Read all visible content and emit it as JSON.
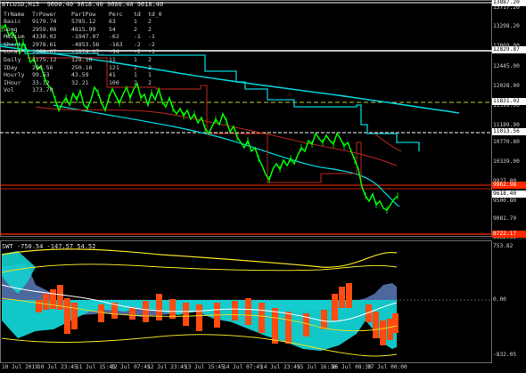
{
  "header": {
    "title": "BTCUSD,M15  9600.40 9618.40 9600.40 9618.40"
  },
  "legend": {
    "columns": [
      "TrName",
      "TrPower",
      "PartPow",
      "Perc",
      "td",
      "td_0"
    ],
    "rows": [
      [
        "Basic",
        "9179.74",
        "5785.12",
        "63",
        "1",
        "2"
      ],
      [
        "Long",
        "2959.06",
        "4815.99",
        "54",
        "2",
        "2"
      ],
      [
        "Medium",
        "4330.02",
        "-1947.07",
        "-62",
        "-1",
        "-1"
      ],
      [
        "Short",
        "2978.61",
        "-4853.56",
        "-163",
        "-2",
        "-2"
      ],
      [
        "Local",
        "2001.07",
        "-1874.07",
        "-94",
        "-2",
        "-1"
      ],
      [
        "Daily",
        "1175.12",
        "128.10",
        "11",
        "1",
        "2"
      ],
      [
        "IDay",
        "206.56",
        "250.16",
        "121",
        "2",
        "2"
      ],
      [
        "Hourly",
        "99.53",
        "43.59",
        "41",
        "1",
        "1"
      ],
      [
        "IHour",
        "33.12",
        "32.21",
        "100",
        "2",
        "2"
      ],
      [
        "Vol",
        "173.70",
        "",
        "",
        "",
        ""
      ]
    ]
  },
  "indicator_title": "SWT -750.54 -147.57 54.52",
  "price_axis": [
    "13717.20",
    "13298.20",
    "12869.00",
    "12445.00",
    "12028.00",
    "11599.00",
    "11189.90",
    "10770.80",
    "10339.00",
    "9927.00",
    "9500.80",
    "9081.70",
    "8662.60"
  ],
  "price_tags": [
    {
      "value": "13887.20",
      "bg": "#ffffff",
      "fg": "#000000"
    },
    {
      "value": "12829.87",
      "bg": "#ffffff",
      "fg": "#000000"
    },
    {
      "value": "11831.02",
      "bg": "#ffffff",
      "fg": "#000000"
    },
    {
      "value": "11013.56",
      "bg": "#ffffff",
      "fg": "#000000"
    },
    {
      "value": "9962.98",
      "bg": "#ff2a00",
      "fg": "#ffffff"
    },
    {
      "value": "9618.40",
      "bg": "#ffffff",
      "fg": "#000000"
    },
    {
      "value": "8722.17",
      "bg": "#ff2a00",
      "fg": "#ffffff"
    }
  ],
  "indicator_axis": [
    "753.82",
    "0.00",
    "-832.05"
  ],
  "time_axis": [
    "10 Jul 2019",
    "10 Jul 23:45",
    "11 Jul 15:45",
    "12 Jul 07:45",
    "12 Jul 23:45",
    "13 Jul 15:45",
    "14 Jul 07:45",
    "14 Jul 23:45",
    "15 Jul 16:30",
    "16 Jul 08:30",
    "17 Jul 00:00"
  ],
  "colors": {
    "background": "#000000",
    "candles": "#00ff00",
    "cyan_ma": "#00cfd6",
    "red_ma": "#c0281b",
    "tag_red": "#ff2a00",
    "dashed_level": "#c8d22a",
    "histogram_orange": "#ff4a10",
    "histogram_cyan": "#12d2d2",
    "histogram_steel": "#5a7ab8",
    "yellow_band": "#f0e020"
  }
}
